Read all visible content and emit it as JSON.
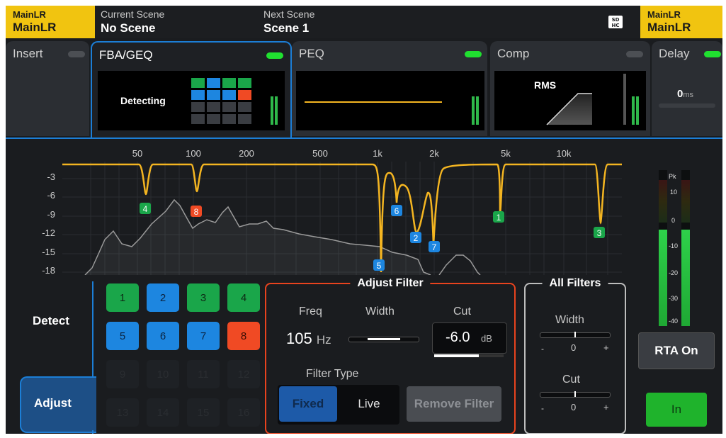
{
  "topbar": {
    "left_bus": {
      "line1": "MainLR",
      "line2": "MainLR"
    },
    "current_scene": {
      "label": "Current Scene",
      "value": "No Scene"
    },
    "next_scene": {
      "label": "Next Scene",
      "value": "Scene 1"
    },
    "right_bus": {
      "line1": "MainLR",
      "line2": "MainLR"
    },
    "sd_icon": "sd-card-icon"
  },
  "tabs": [
    {
      "label": "Insert",
      "led": false
    },
    {
      "label": "FBA/GEQ",
      "led": true,
      "active": true,
      "screen_text": "Detecting"
    },
    {
      "label": "PEQ",
      "led": true
    },
    {
      "label": "Comp",
      "led": false,
      "screen_text": "RMS"
    },
    {
      "label": "Delay",
      "led": true,
      "value": "0",
      "unit": "ms"
    }
  ],
  "graph": {
    "y_labels": [
      "-3",
      "-6",
      "-9",
      "-12",
      "-15",
      "-18"
    ],
    "x_labels": [
      "50",
      "100",
      "200",
      "500",
      "1k",
      "2k",
      "5k",
      "10k"
    ],
    "notch_markers": [
      {
        "label": "4",
        "color": "green"
      },
      {
        "label": "8",
        "color": "red"
      },
      {
        "label": "6",
        "color": "blue"
      },
      {
        "label": "2",
        "color": "blue"
      },
      {
        "label": "7",
        "color": "blue"
      },
      {
        "label": "5",
        "color": "blue"
      },
      {
        "label": "1",
        "color": "green"
      },
      {
        "label": "3",
        "color": "green"
      }
    ]
  },
  "meter": {
    "scale": [
      "Pk",
      "10",
      "0",
      "-10",
      "-20",
      "-30",
      "-40"
    ],
    "level_fraction": 0.62
  },
  "modes": {
    "detect": "Detect",
    "adjust": "Adjust"
  },
  "filters": [
    {
      "label": "1",
      "color": "green"
    },
    {
      "label": "2",
      "color": "blue"
    },
    {
      "label": "3",
      "color": "green"
    },
    {
      "label": "4",
      "color": "green"
    },
    {
      "label": "5",
      "color": "blue"
    },
    {
      "label": "6",
      "color": "blue"
    },
    {
      "label": "7",
      "color": "blue"
    },
    {
      "label": "8",
      "color": "red"
    },
    {
      "label": "9",
      "color": "empty"
    },
    {
      "label": "10",
      "color": "empty"
    },
    {
      "label": "11",
      "color": "empty"
    },
    {
      "label": "12",
      "color": "empty"
    },
    {
      "label": "13",
      "color": "empty"
    },
    {
      "label": "14",
      "color": "empty"
    },
    {
      "label": "15",
      "color": "empty"
    },
    {
      "label": "16",
      "color": "empty"
    }
  ],
  "adjust_filter": {
    "title": "Adjust Filter",
    "freq_label": "Freq",
    "freq_value": "105",
    "freq_unit": "Hz",
    "width_label": "Width",
    "cut_label": "Cut",
    "cut_value": "-6.0",
    "cut_unit": "dB",
    "filter_type_label": "Filter Type",
    "type_fixed": "Fixed",
    "type_live": "Live",
    "remove_button": "Remove Filter"
  },
  "all_filters": {
    "title": "All Filters",
    "width_label": "Width",
    "width_minus": "-",
    "width_value": "0",
    "width_plus": "+",
    "cut_label": "Cut",
    "cut_minus": "-",
    "cut_value": "0",
    "cut_plus": "+"
  },
  "buttons": {
    "rta": "RTA On",
    "in": "In"
  },
  "colors": {
    "accent": "#1c7ed6",
    "eq_curve": "#f4b521",
    "green": "#1aa64a",
    "blue": "#1d86e0",
    "red": "#f04a24",
    "yellow": "#f1c410"
  }
}
